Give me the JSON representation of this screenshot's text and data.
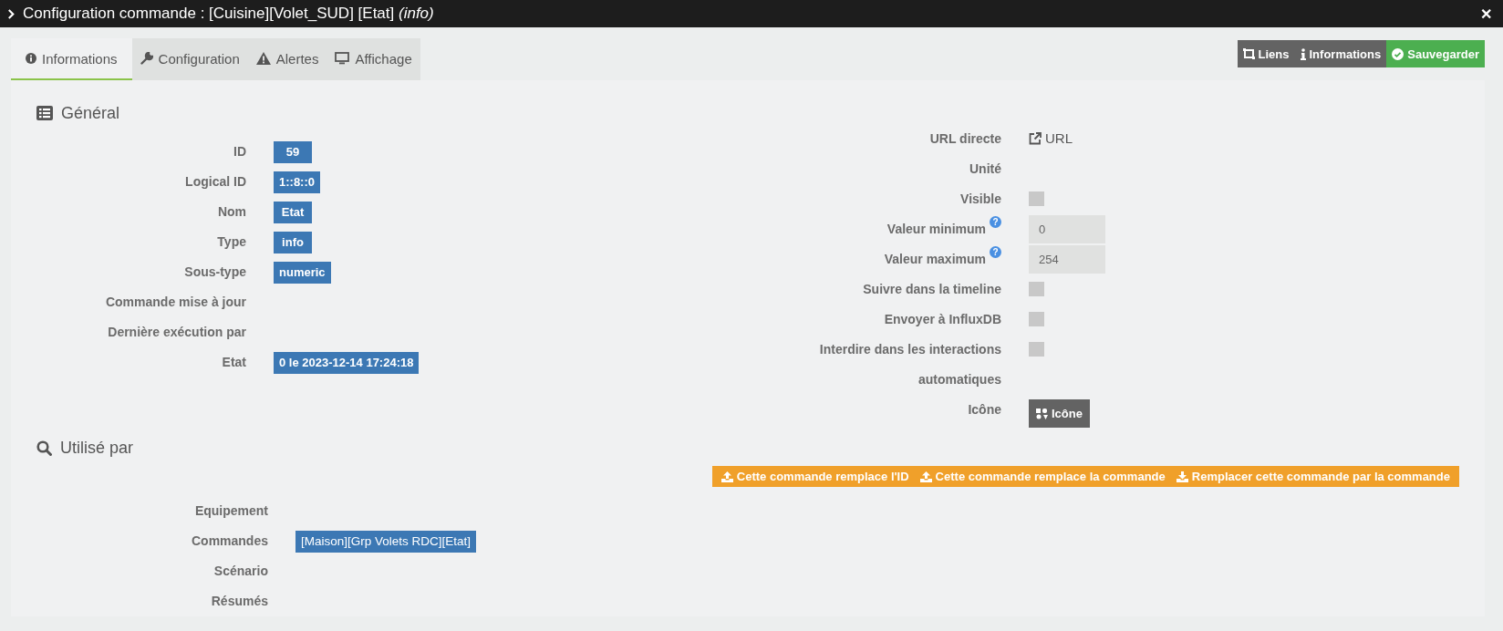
{
  "window": {
    "title": "Configuration commande : [Cuisine][Volet_SUD] [Etat] *(info)*",
    "close": "✕"
  },
  "tabs": [
    {
      "label": "Informations",
      "selected": true
    },
    {
      "label": "Configuration",
      "selected": false
    },
    {
      "label": "Alertes",
      "selected": false
    },
    {
      "label": "Affichage",
      "selected": false
    }
  ],
  "actions": [
    {
      "label": "Liens",
      "kind": "dark"
    },
    {
      "label": "Informations",
      "kind": "dark"
    },
    {
      "label": "Sauvegarder",
      "kind": "success"
    }
  ],
  "general": {
    "title": "Général",
    "rows": [
      {
        "label": "ID",
        "value": "59"
      },
      {
        "label": "Logical ID",
        "value": "1::8::0"
      },
      {
        "label": "Nom",
        "value": "Etat"
      },
      {
        "label": "Type",
        "value": "info"
      },
      {
        "label": "Sous-type",
        "value": "numeric"
      },
      {
        "label": "Commande mise à jour"
      },
      {
        "label": "Dernière exécution par"
      },
      {
        "label": "Etat",
        "value": "0 le 2023-12-14 17:24:18"
      }
    ]
  },
  "settings": [
    {
      "kind": "link",
      "label": "URL directe",
      "value": "URL"
    },
    {
      "kind": "text",
      "label": "Unité"
    },
    {
      "kind": "checkbox",
      "label": "Visible",
      "checked": false
    },
    {
      "kind": "input",
      "label": "Valeur minimum",
      "help": "?",
      "value": "0"
    },
    {
      "kind": "input",
      "label": "Valeur maximum",
      "help": "?",
      "value": "254"
    },
    {
      "kind": "checkbox",
      "label": "Suivre dans la timeline",
      "checked": false
    },
    {
      "kind": "checkbox",
      "label": "Envoyer à InfluxDB",
      "checked": false
    },
    {
      "kind": "checkbox",
      "label": "Interdire dans les interactions automatiques",
      "checked": false
    },
    {
      "kind": "button",
      "label": "Icône",
      "value": "Icône"
    }
  ],
  "used_by": {
    "title": "Utilisé par",
    "buttons": [
      {
        "label": "Cette commande remplace l'ID"
      },
      {
        "label": "Cette commande remplace la commande"
      },
      {
        "label": "Remplacer cette commande par la commande"
      }
    ],
    "rows": [
      {
        "label": "Equipement",
        "values": []
      },
      {
        "label": "Commandes",
        "values": [
          "[Maison][Grp Volets RDC][Etat]"
        ]
      },
      {
        "label": "Scénario",
        "values": []
      },
      {
        "label": "Résumés",
        "values": []
      }
    ]
  }
}
